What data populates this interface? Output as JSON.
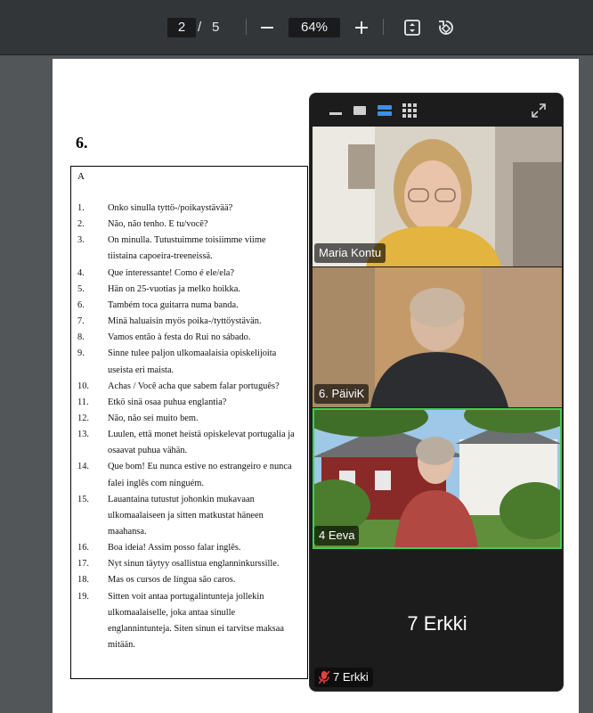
{
  "toolbar": {
    "current_page": "2",
    "separator": "/",
    "total_pages": "5",
    "zoom": "64%",
    "icons": [
      "zoom-out-icon",
      "zoom-in-icon",
      "fit-page-icon",
      "rotate-icon"
    ]
  },
  "document": {
    "question_number": "6.",
    "section_label": "A",
    "lines": [
      {
        "num": "1.",
        "text": [
          "Onko sinulla tyttö-/poikaystävää?"
        ]
      },
      {
        "num": "2.",
        "text": [
          "Não, não tenho. E tu/você?"
        ]
      },
      {
        "num": "3.",
        "text": [
          "On minulla. Tutustuimme toisiimme viime",
          "tiistaina capoeira-treeneissä."
        ]
      },
      {
        "num": "4.",
        "text": [
          "Que interessante! Como é ele/ela?"
        ]
      },
      {
        "num": "5.",
        "text": [
          "Hän on 25-vuotias ja melko hoikka."
        ]
      },
      {
        "num": "6.",
        "text": [
          "Também toca guitarra numa banda."
        ]
      },
      {
        "num": "7.",
        "text": [
          "Minä haluaisin myös poika-/tyttöystävän."
        ]
      },
      {
        "num": "8.",
        "text": [
          "Vamos então à festa do Rui no sábado."
        ]
      },
      {
        "num": "9.",
        "text": [
          "Sinne tulee paljon ulkomaalaisia opiskelijoita",
          "useista eri maista."
        ]
      },
      {
        "num": "10.",
        "text": [
          "Achas / Você acha que sabem falar português?"
        ]
      },
      {
        "num": "11.",
        "text": [
          "Etkö sinä osaa puhua englantia?"
        ]
      },
      {
        "num": "12.",
        "text": [
          "Não, não sei muito bem."
        ]
      },
      {
        "num": "13.",
        "text": [
          "Luulen, että monet heistä opiskelevat portugalia ja",
          "osaavat puhua vähän."
        ]
      },
      {
        "num": "14.",
        "text": [
          "Que bom! Eu nunca estive no estrangeiro e nunca",
          "falei inglês com ninguém."
        ]
      },
      {
        "num": "15.",
        "text": [
          "Lauantaina tutustut johonkin mukavaan",
          "ulkomaalaiseen ja sitten matkustat häneen",
          "maahansa."
        ]
      },
      {
        "num": "16.",
        "text": [
          "Boa ideia! Assim posso falar inglês."
        ]
      },
      {
        "num": "17.",
        "text": [
          "Nyt sinun täytyy osallistua englanninkurssille."
        ]
      },
      {
        "num": "18.",
        "text": [
          "Mas os cursos de língua são caros."
        ]
      },
      {
        "num": "19.",
        "text": [
          "Sitten voit antaa portugalintunteja jollekin",
          "ulkomaalaiselle, joka antaa sinulle",
          "englannintunteja. Siten sinun ei tarvitse maksaa",
          "mitään."
        ]
      }
    ]
  },
  "video_panel": {
    "participants": [
      {
        "name": "Maria Kontu"
      },
      {
        "name": "6. PäiviK"
      },
      {
        "name": "4 Eeva"
      }
    ],
    "no_video_participant": {
      "display_name": "7 Erkki",
      "tag": "7 Erkki",
      "muted": true
    },
    "active_speaker_color": "#3fcf52"
  }
}
